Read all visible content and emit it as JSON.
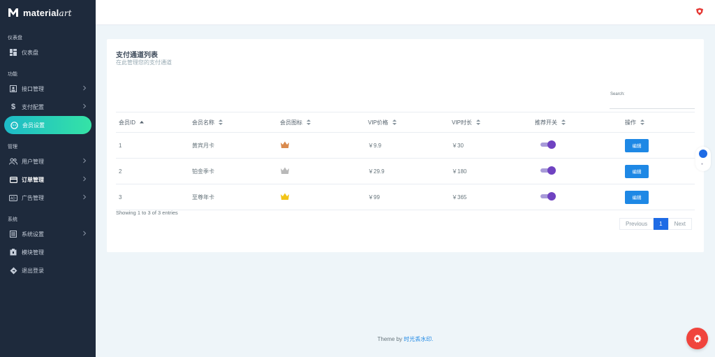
{
  "brand": {
    "name": "material",
    "name_suffix": "art"
  },
  "sidebar": {
    "sections": [
      {
        "label": "仪表盘",
        "items": [
          {
            "label": "仪表盘",
            "icon": "dashboard-icon",
            "has_chevron": false
          }
        ]
      },
      {
        "label": "功能",
        "items": [
          {
            "label": "接口管理",
            "icon": "api-icon",
            "has_chevron": true
          },
          {
            "label": "支付配置",
            "icon": "dollar-icon",
            "has_chevron": true
          },
          {
            "label": "会员设置",
            "icon": "member-icon",
            "has_chevron": false,
            "active": true
          }
        ]
      },
      {
        "label": "管理",
        "items": [
          {
            "label": "用户管理",
            "icon": "users-icon",
            "has_chevron": true
          },
          {
            "label": "订单管理",
            "icon": "card-icon",
            "has_chevron": true
          },
          {
            "label": "广告管理",
            "icon": "ad-icon",
            "has_chevron": true
          }
        ]
      },
      {
        "label": "系统",
        "items": [
          {
            "label": "系统设置",
            "icon": "settings-list-icon",
            "has_chevron": true
          },
          {
            "label": "模块管理",
            "icon": "module-icon",
            "has_chevron": false
          },
          {
            "label": "退出登录",
            "icon": "logout-icon",
            "has_chevron": false
          }
        ]
      }
    ]
  },
  "card": {
    "title": "支付通道列表",
    "subtitle": "在此管理您的支付通道",
    "search_label": "Search:",
    "search_value": ""
  },
  "table": {
    "headers": [
      "会员ID",
      "会员名称",
      "会员图标",
      "VIP价格",
      "VIP时长",
      "推荐开关",
      "操作"
    ],
    "rows": [
      {
        "id": "1",
        "name": "黄宾月卡",
        "icon_color": "#d98a4e",
        "price": "￥9.9",
        "duration": "￥30",
        "recommend": true,
        "action": "编辑"
      },
      {
        "id": "2",
        "name": "铂金季卡",
        "icon_color": "#b9b9b9",
        "price": "￥29.9",
        "duration": "￥180",
        "recommend": true,
        "action": "编辑"
      },
      {
        "id": "3",
        "name": "至尊年卡",
        "icon_color": "#f2c417",
        "price": "￥99",
        "duration": "￥365",
        "recommend": true,
        "action": "编辑"
      }
    ]
  },
  "pagination": {
    "info": "Showing 1 to 3 of 3 entries",
    "previous": "Previous",
    "current": "1",
    "next": "Next"
  },
  "footer": {
    "prefix": "Theme by ",
    "link": "时光丢水印."
  },
  "colors": {
    "sidebar_bg": "#1e2a3c",
    "active_gradient_start": "#1dbac8",
    "active_gradient_end": "#35e3a6",
    "primary": "#1e88e5",
    "toggle": "#6f42c1",
    "fab": "#f0443d"
  }
}
